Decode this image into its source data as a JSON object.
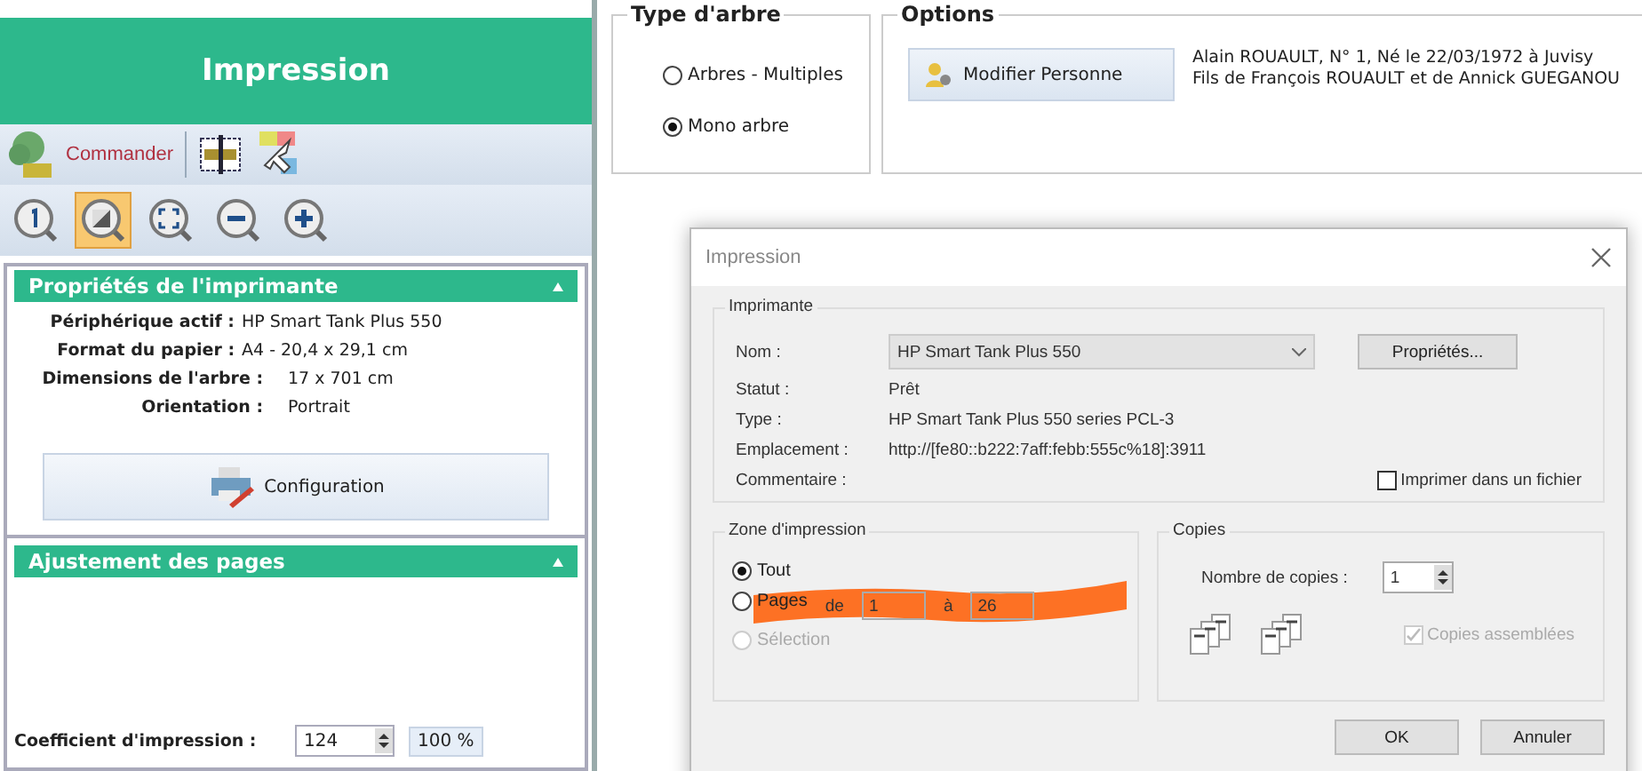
{
  "header": {
    "title": "Impression"
  },
  "toolbar": {
    "commander": "Commander"
  },
  "zoom_buttons": [
    {
      "kind": "one",
      "selected": false
    },
    {
      "kind": "page",
      "selected": true
    },
    {
      "kind": "fit",
      "selected": false
    },
    {
      "kind": "minus",
      "selected": false
    },
    {
      "kind": "plus",
      "selected": false
    }
  ],
  "printer_panel": {
    "title": "Propriétés de l'imprimante",
    "properties": [
      {
        "label": "Périphérique actif :",
        "value": "HP Smart Tank Plus 550",
        "kind": "wide"
      },
      {
        "label": "Format du papier :",
        "value": "A4 - 20,4 x 29,1 cm",
        "kind": "wide"
      },
      {
        "label": "Dimensions de l'arbre :",
        "value": "17 x 701 cm",
        "kind": "narrow"
      },
      {
        "label": "Orientation :",
        "value": "Portrait",
        "kind": "narrow"
      }
    ],
    "config_button": "Configuration"
  },
  "adjust_panel": {
    "title": "Ajustement des pages",
    "coefficient_label": "Coefficient d'impression :",
    "coefficient": "124",
    "percent": "100 %"
  },
  "tree_type": {
    "title": "Type d'arbre",
    "options": [
      {
        "label": "Arbres - Multiples",
        "selected": false
      },
      {
        "label": "Mono arbre",
        "selected": true
      }
    ]
  },
  "options": {
    "title": "Options",
    "button": "Modifier Personne",
    "person_lines": [
      "Alain ROUAULT, N° 1, Né le 22/03/1972 à Juvisy",
      "Fils de François ROUAULT et de Annick GUEGANOU"
    ]
  },
  "dialog": {
    "title": "Impression",
    "printer": {
      "title": "Imprimante",
      "name_label": "Nom :",
      "name": "HP Smart Tank Plus 550",
      "properties_button": "Propriétés...",
      "rows": [
        {
          "label": "Statut :",
          "value": "Prêt"
        },
        {
          "label": "Type :",
          "value": "HP Smart Tank Plus 550 series PCL-3"
        },
        {
          "label": "Emplacement :",
          "value": "http://[fe80::b222:7aff:febb:555c%18]:3911"
        },
        {
          "label": "Commentaire :",
          "value": ""
        }
      ],
      "print_to_file": {
        "label": "Imprimer dans un fichier",
        "checked": false
      }
    },
    "zone": {
      "title": "Zone d'impression",
      "options": [
        {
          "label": "Tout",
          "selected": true,
          "disabled": false
        },
        {
          "label": "Pages",
          "selected": false,
          "disabled": false
        },
        {
          "label": "Sélection",
          "selected": false,
          "disabled": true
        }
      ],
      "from_label": "de",
      "from": "1",
      "to_label": "à",
      "to": "26"
    },
    "copies": {
      "title": "Copies",
      "count_label": "Nombre de copies :",
      "count": "1",
      "collate": {
        "label": "Copies assemblées",
        "checked": true,
        "disabled": true
      }
    },
    "buttons": [
      "OK",
      "Annuler"
    ]
  }
}
